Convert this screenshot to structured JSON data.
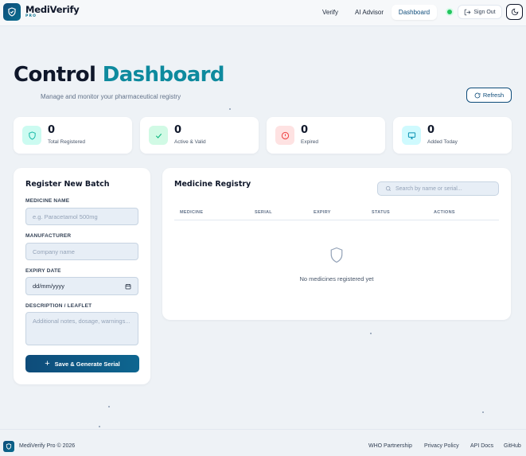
{
  "header": {
    "brand_name": "MediVerify",
    "brand_sub": "PRO",
    "nav": [
      "Verify",
      "AI Advisor",
      "Dashboard"
    ],
    "active_nav": "Dashboard",
    "signout_label": "Sign Out"
  },
  "page": {
    "title_part1": "Control",
    "title_part2": "Dashboard",
    "subtitle": "Manage and monitor your pharmaceutical registry",
    "refresh_label": "Refresh"
  },
  "stats": [
    {
      "value": "0",
      "label": "Total Registered",
      "icon": "shield-icon",
      "color": "#14b8a6"
    },
    {
      "value": "0",
      "label": "Active & Valid",
      "icon": "check-icon",
      "color": "#10b981"
    },
    {
      "value": "0",
      "label": "Expired",
      "icon": "alert-circle-icon",
      "color": "#ef4444"
    },
    {
      "value": "0",
      "label": "Added Today",
      "icon": "monitor-icon",
      "color": "#0891b2"
    }
  ],
  "register": {
    "title": "Register New Batch",
    "name_label": "MEDICINE NAME",
    "name_placeholder": "e.g. Paracetamol 500mg",
    "manufacturer_label": "MANUFACTURER",
    "manufacturer_placeholder": "Company name",
    "expiry_label": "EXPIRY DATE",
    "expiry_value": "dd/mm/yyyy",
    "description_label": "DESCRIPTION / LEAFLET",
    "description_placeholder": "Additional notes, dosage, warnings...",
    "save_label": "Save & Generate Serial"
  },
  "registry": {
    "title": "Medicine Registry",
    "search_placeholder": "Search by name or serial...",
    "columns": [
      "MEDICINE",
      "SERIAL",
      "EXPIRY",
      "STATUS",
      "ACTIONS"
    ],
    "empty_text": "No medicines registered yet"
  },
  "footer": {
    "copyright": "MediVerify Pro © 2026",
    "links": [
      "WHO Partnership",
      "Privacy Policy",
      "API Docs",
      "GitHub"
    ]
  }
}
